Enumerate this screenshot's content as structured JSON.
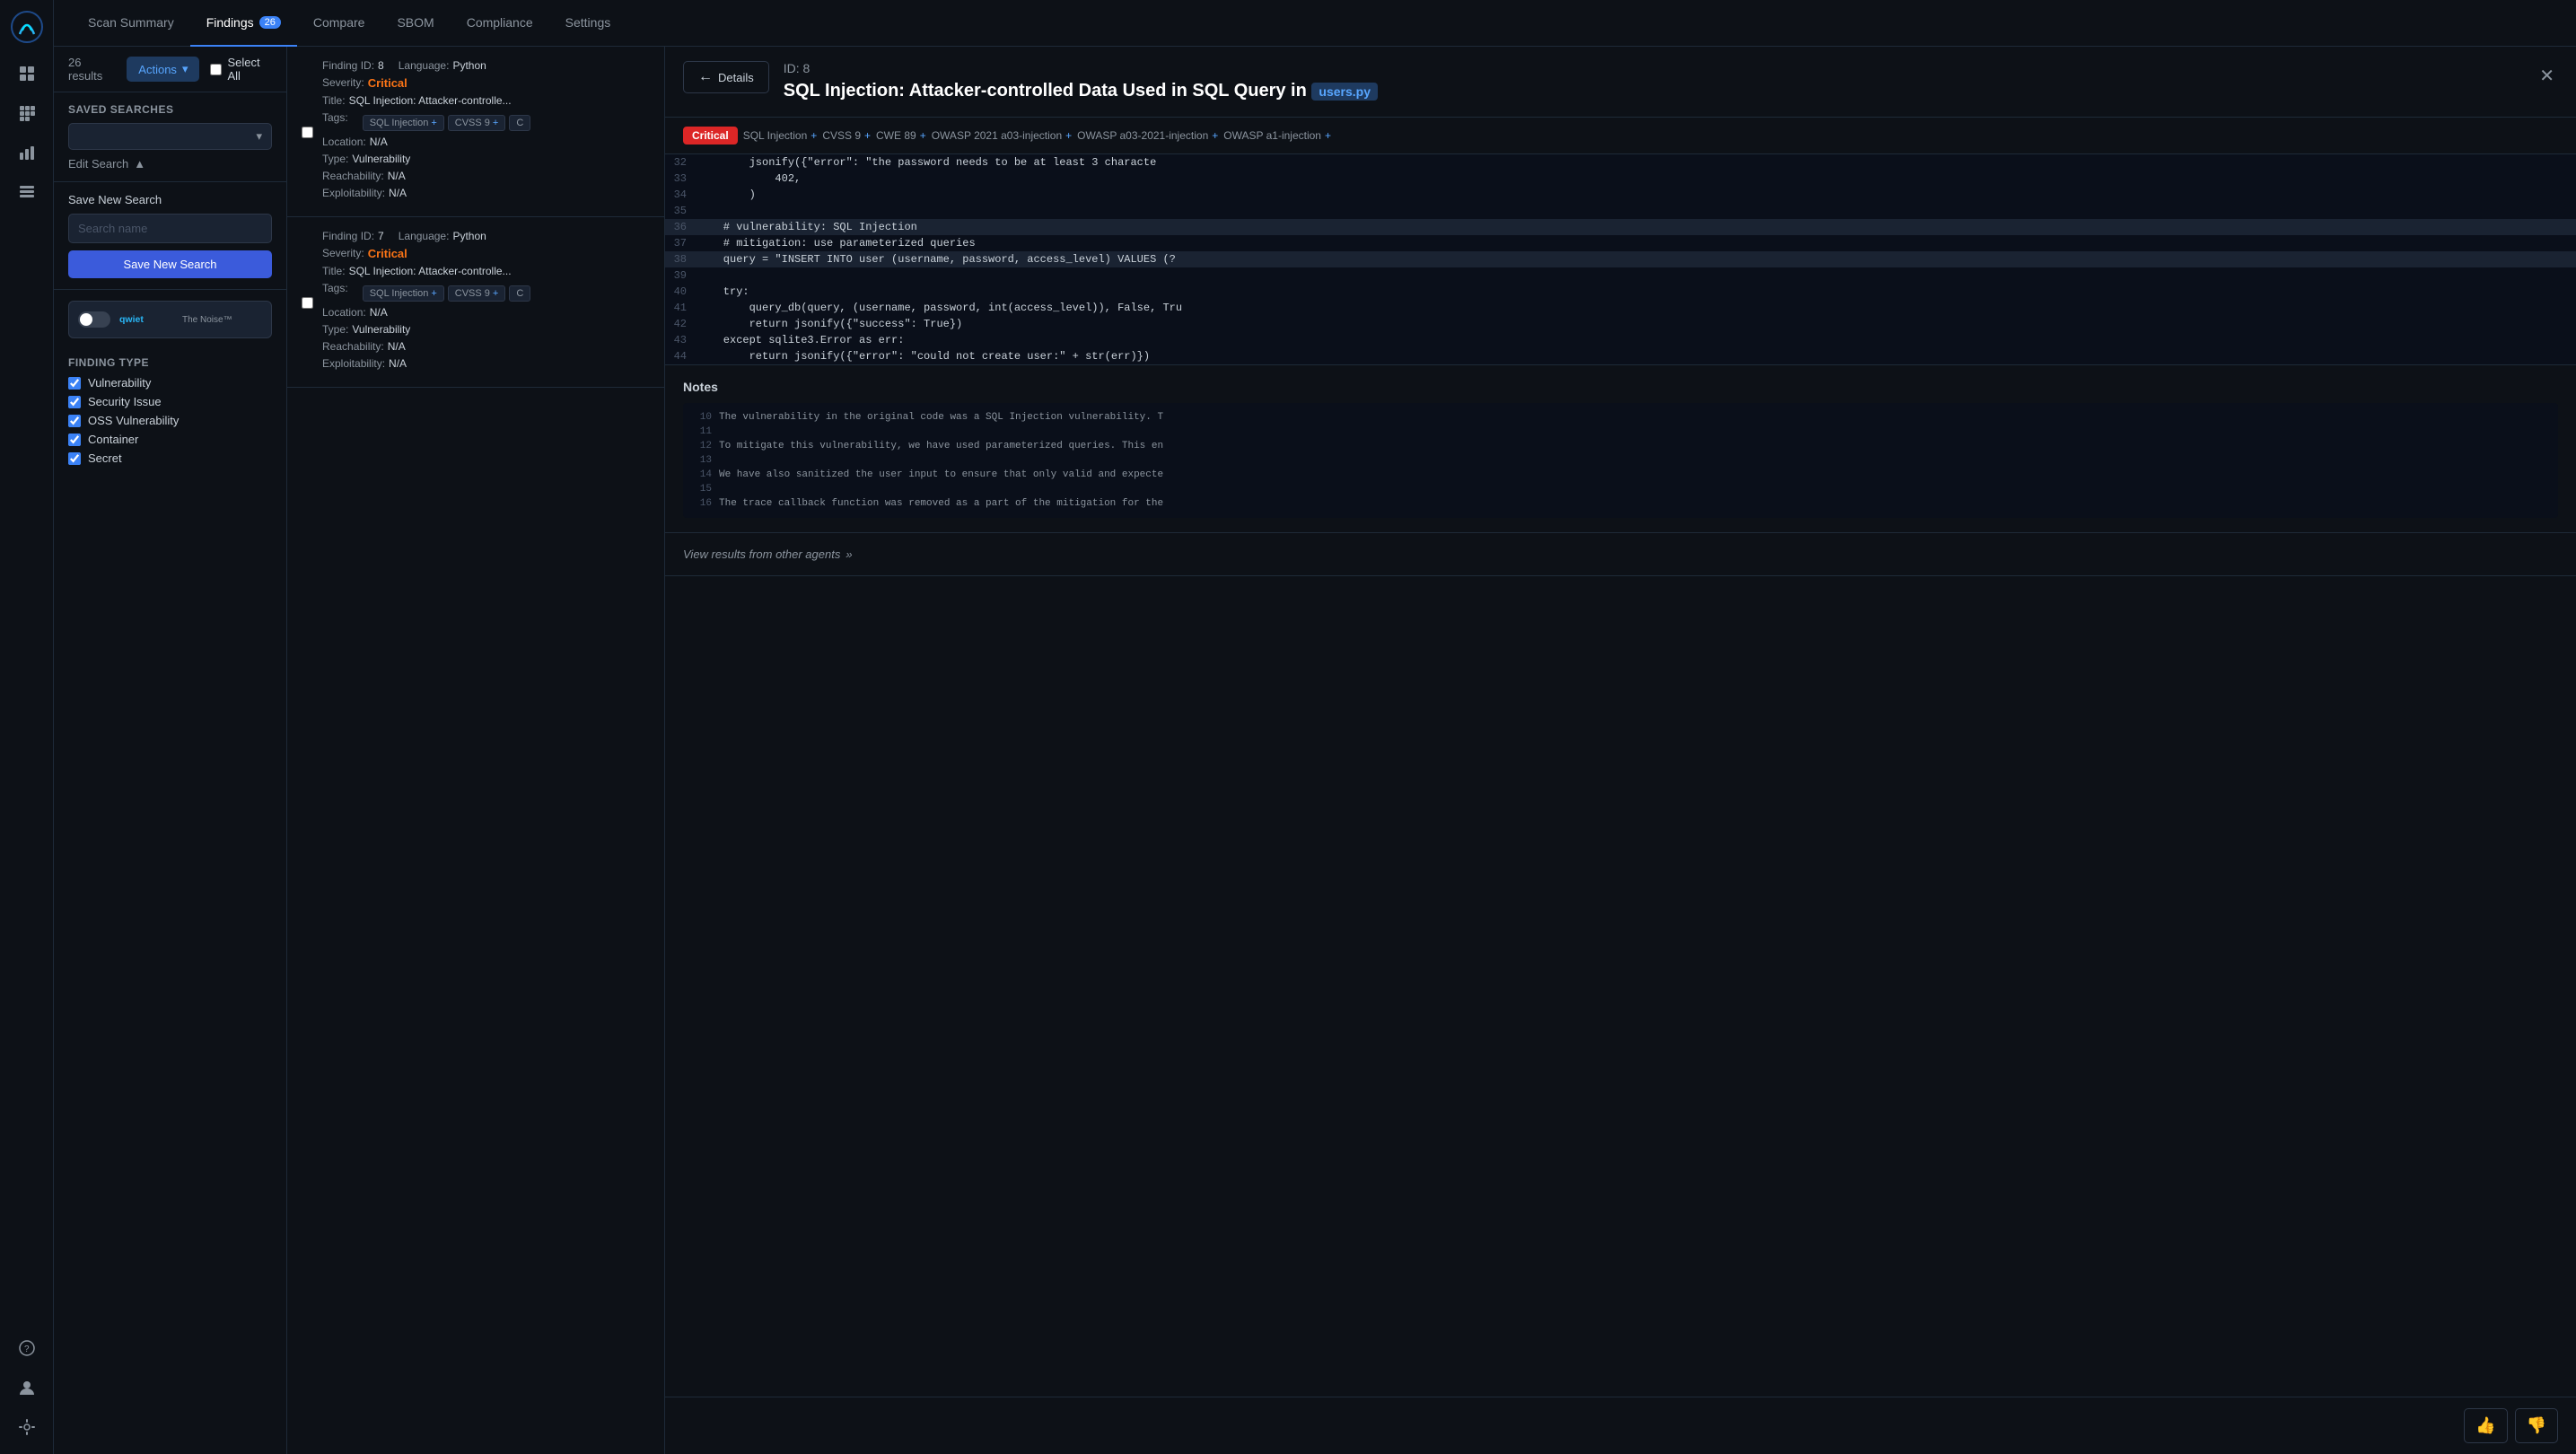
{
  "app": {
    "title": "Scan Summary"
  },
  "nav": {
    "tabs": [
      {
        "id": "scan-summary",
        "label": "Scan Summary",
        "active": false,
        "badge": null
      },
      {
        "id": "findings",
        "label": "Findings",
        "active": true,
        "badge": "26"
      },
      {
        "id": "compare",
        "label": "Compare",
        "active": false,
        "badge": null
      },
      {
        "id": "sbom",
        "label": "SBOM",
        "active": false,
        "badge": null
      },
      {
        "id": "compliance",
        "label": "Compliance",
        "active": false,
        "badge": null
      },
      {
        "id": "settings",
        "label": "Settings",
        "active": false,
        "badge": null
      }
    ]
  },
  "toolbar": {
    "results_count": "26 results",
    "actions_label": "Actions",
    "select_all_label": "Select All"
  },
  "filter": {
    "saved_searches_label": "Saved Searches",
    "edit_search_label": "Edit Search",
    "save_new_search_label": "Save New Search",
    "search_name_placeholder": "Search name",
    "save_new_btn_label": "Save New Search",
    "finding_type_label": "Finding Type",
    "finding_types": [
      {
        "label": "Vulnerability",
        "checked": true
      },
      {
        "label": "Security Issue",
        "checked": true
      },
      {
        "label": "OSS Vulnerability",
        "checked": true
      },
      {
        "label": "Container",
        "checked": true
      },
      {
        "label": "Secret",
        "checked": true
      }
    ],
    "qwiet_label": "qwiet",
    "qwiet_sub": "The Noise™"
  },
  "findings": [
    {
      "id": "8",
      "language": "Python",
      "severity": "Critical",
      "title": "SQL Injection: Attacker-controlled Data Used in SQL Query",
      "tags": [
        "SQL Injection",
        "+",
        "CVSS 9",
        "+",
        "C"
      ],
      "location": "N/A",
      "type": "Vulnerability",
      "reachability": "N/A",
      "exploitability": "N/A"
    },
    {
      "id": "7",
      "language": "Python",
      "severity": "Critical",
      "title": "SQL Injection: Attacker-controlled Data Used in SQL Query",
      "tags": [
        "SQL Injection",
        "+",
        "CVSS 9",
        "+",
        "C"
      ],
      "location": "N/A",
      "type": "Vulnerability",
      "reachability": "N/A",
      "exploitability": "N/A"
    }
  ],
  "detail": {
    "id_label": "ID: 8",
    "details_btn": "Details",
    "title": "SQL Injection: Attacker-controlled Data Used in SQL Query in",
    "filename": "users.py",
    "critical_label": "Critical",
    "tags": [
      {
        "text": "SQL Injection",
        "plus": true
      },
      {
        "text": "CVSS 9",
        "plus": true
      },
      {
        "text": "CWE 89",
        "plus": true
      },
      {
        "text": "OWASP 2021 a03-injection",
        "plus": true
      },
      {
        "text": "OWASP a03-2021-injection",
        "plus": true
      },
      {
        "text": "OWASP a1-injection",
        "plus": true
      }
    ],
    "code_lines": [
      {
        "num": 32,
        "content": "        jsonify({\"error\": \"the password needs to be at least 3 characte",
        "highlight": false
      },
      {
        "num": 33,
        "content": "            402,",
        "highlight": false
      },
      {
        "num": 34,
        "content": "        )",
        "highlight": false
      },
      {
        "num": 35,
        "content": "",
        "highlight": false
      },
      {
        "num": 36,
        "content": "    # vulnerability: SQL Injection",
        "highlight": true
      },
      {
        "num": 37,
        "content": "    # mitigation: use parameterized queries",
        "highlight": false
      },
      {
        "num": 38,
        "content": "    query = \"INSERT INTO user (username, password, access_level) VALUES (?",
        "highlight": true
      },
      {
        "num": 39,
        "content": "",
        "highlight": false
      },
      {
        "num": 40,
        "content": "    try:",
        "highlight": false
      },
      {
        "num": 41,
        "content": "        query_db(query, (username, password, int(access_level)), False, Tru",
        "highlight": false
      },
      {
        "num": 42,
        "content": "        return jsonify({\"success\": True})",
        "highlight": false
      },
      {
        "num": 43,
        "content": "    except sqlite3.Error as err:",
        "highlight": false
      },
      {
        "num": 44,
        "content": "        return jsonify({\"error\": \"could not create user:\" + str(err)})",
        "highlight": false
      }
    ],
    "notes_title": "Notes",
    "notes_lines": [
      {
        "num": 10,
        "content": "The vulnerability in the original code was a SQL Injection vulnerability. T"
      },
      {
        "num": 11,
        "content": ""
      },
      {
        "num": 12,
        "content": "To mitigate this vulnerability, we have used parameterized queries. This en"
      },
      {
        "num": 13,
        "content": ""
      },
      {
        "num": 14,
        "content": "We have also sanitized the user input to ensure that only valid and expecte"
      },
      {
        "num": 15,
        "content": ""
      },
      {
        "num": 16,
        "content": "The trace callback function was removed as a part of the mitigation for the"
      }
    ],
    "view_results_label": "View results from other agents",
    "thumb_up": "👍",
    "thumb_down": "👎"
  },
  "sidebar": {
    "icons": [
      {
        "name": "home-icon",
        "symbol": "⊞"
      },
      {
        "name": "grid-icon",
        "symbol": "⊟"
      },
      {
        "name": "chart-icon",
        "symbol": "▦"
      },
      {
        "name": "list-icon",
        "symbol": "☰"
      },
      {
        "name": "help-icon",
        "symbol": "?"
      },
      {
        "name": "user-icon",
        "symbol": "👤"
      }
    ]
  }
}
